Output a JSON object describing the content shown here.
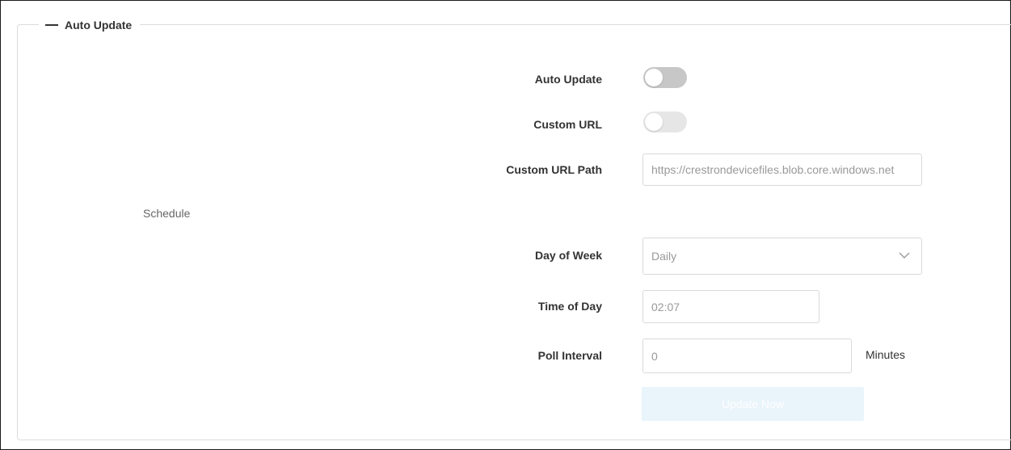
{
  "section": {
    "title": "Auto Update",
    "collapse_icon": "minus-icon"
  },
  "fields": {
    "auto_update": {
      "label": "Auto Update",
      "enabled": false
    },
    "custom_url": {
      "label": "Custom URL",
      "enabled": false
    },
    "custom_url_path": {
      "label": "Custom URL Path",
      "value": "https://crestrondevicefiles.blob.core.windows.net"
    },
    "schedule_label": "Schedule",
    "day_of_week": {
      "label": "Day of Week",
      "value": "Daily",
      "chevron_icon": "chevron-down-icon"
    },
    "time_of_day": {
      "label": "Time of Day",
      "value": "02:07"
    },
    "poll_interval": {
      "label": "Poll Interval",
      "value": "0",
      "unit": "Minutes"
    }
  },
  "actions": {
    "update_now_label": "Update Now"
  },
  "colors": {
    "toggle_off": "#c7c7c7",
    "toggle_disabled": "#e6e6e6",
    "button_disabled_bg": "#eaf4fb"
  }
}
